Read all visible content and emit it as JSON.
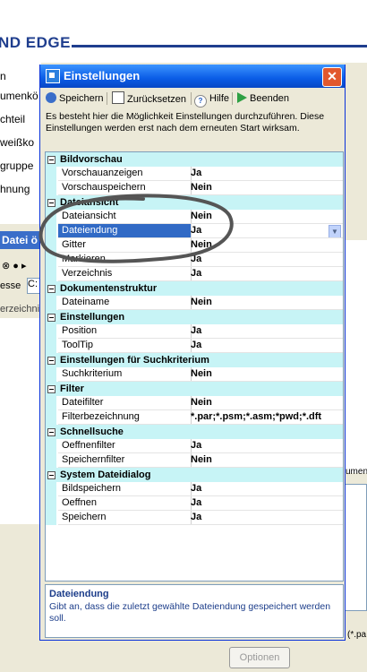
{
  "background": {
    "app_title": "ND EDGE",
    "side_items": [
      "n",
      "umenkö",
      "chteil",
      "weißko",
      "gruppe",
      "hnung"
    ],
    "side_bar": "Datei ö",
    "address_label": "esse",
    "address_value": "C:",
    "list_header": "erzeichnis",
    "right_text": "umen",
    "right_path": "(*.pa",
    "optionen_button": "Optionen"
  },
  "dialog": {
    "title": "Einstellungen",
    "close": "✕",
    "toolbar": {
      "save": "Speichern",
      "reset": "Zurücksetzen",
      "help": "Hilfe",
      "exit": "Beenden"
    },
    "info_text": "Es besteht hier die Möglichkeit Einstellungen durchzuführen. Diese Einstellungen werden erst nach dem erneuten Start wirksam.",
    "categories": [
      {
        "name": "Bildvorschau",
        "props": [
          {
            "name": "Vorschauanzeigen",
            "value": "Ja"
          },
          {
            "name": "Vorschauspeichern",
            "value": "Nein"
          }
        ]
      },
      {
        "name": "Dateiansicht",
        "props": [
          {
            "name": "Dateiansicht",
            "value": "Nein"
          },
          {
            "name": "Dateiendung",
            "value": "Ja",
            "selected": true
          },
          {
            "name": "Gitter",
            "value": "Nein"
          },
          {
            "name": "Markieren",
            "value": "Ja"
          },
          {
            "name": "Verzeichnis",
            "value": "Ja"
          }
        ]
      },
      {
        "name": "Dokumentenstruktur",
        "props": [
          {
            "name": "Dateiname",
            "value": "Nein"
          }
        ]
      },
      {
        "name": "Einstellungen",
        "props": [
          {
            "name": "Position",
            "value": "Ja"
          },
          {
            "name": "ToolTip",
            "value": "Ja"
          }
        ]
      },
      {
        "name": "Einstellungen für Suchkriterium",
        "props": [
          {
            "name": "Suchkriterium",
            "value": "Nein"
          }
        ]
      },
      {
        "name": "Filter",
        "props": [
          {
            "name": "Dateifilter",
            "value": "Nein"
          },
          {
            "name": "Filterbezeichnung",
            "value": "*.par;*.psm;*.asm;*pwd;*.dft"
          }
        ]
      },
      {
        "name": "Schnellsuche",
        "props": [
          {
            "name": "Oeffnenfilter",
            "value": "Ja"
          },
          {
            "name": "Speichernfilter",
            "value": "Nein"
          }
        ]
      },
      {
        "name": "System Dateidialog",
        "props": [
          {
            "name": "Bildspeichern",
            "value": "Ja"
          },
          {
            "name": "Oeffnen",
            "value": "Ja"
          },
          {
            "name": "Speichern",
            "value": "Ja"
          }
        ]
      }
    ],
    "description": {
      "title": "Dateiendung",
      "text": "Gibt an, dass die zuletzt gewählte Dateiendung gespeichert werden soll."
    },
    "colors": {
      "selection": "#316ac5",
      "category_bg": "#c7f4f6",
      "annotation": "#555555"
    }
  }
}
